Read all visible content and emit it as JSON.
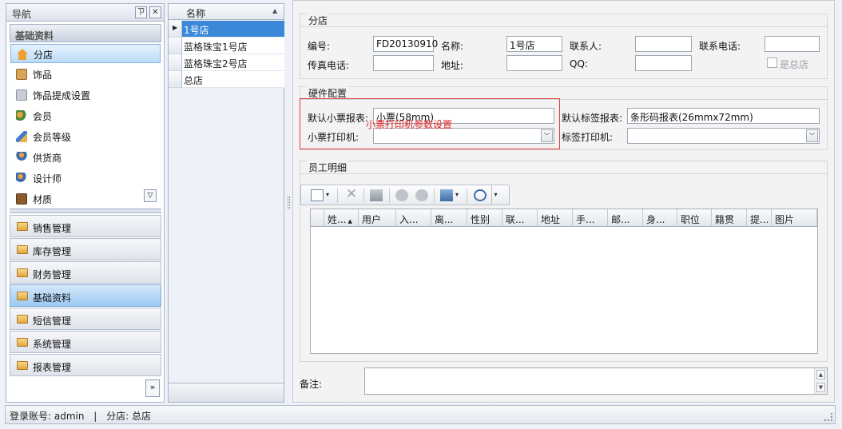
{
  "nav": {
    "title": "导航",
    "pin": "ㄗ",
    "close": "✕",
    "section_title": "基础资料",
    "items": [
      {
        "label": "分店",
        "icon": "home-icon"
      },
      {
        "label": "饰品",
        "icon": "box-icon"
      },
      {
        "label": "饰品提成设置",
        "icon": "gear-doc-icon"
      },
      {
        "label": "会员",
        "icon": "users-icon"
      },
      {
        "label": "会员等级",
        "icon": "pen-icon"
      },
      {
        "label": "供货商",
        "icon": "supplier-icon"
      },
      {
        "label": "设计师",
        "icon": "designer-icon"
      },
      {
        "label": "材质",
        "icon": "material-icon"
      }
    ],
    "groups": [
      "销售管理",
      "库存管理",
      "财务管理",
      "基础资料",
      "短信管理",
      "系统管理",
      "报表管理"
    ]
  },
  "store_list": {
    "header": "名称",
    "rows": [
      "1号店",
      "蓝格珠宝1号店",
      "蓝格珠宝2号店",
      "总店"
    ]
  },
  "store_form": {
    "title": "分店",
    "code_label": "编号:",
    "code_value": "FD20130910",
    "name_label": "名称:",
    "name_value": "1号店",
    "contact_label": "联系人:",
    "contact_value": "",
    "phone_label": "联系电话:",
    "phone_value": "",
    "fax_label": "传真电话:",
    "fax_value": "",
    "address_label": "地址:",
    "address_value": "",
    "qq_label": "QQ:",
    "qq_value": "",
    "headquarters_label": "是总店"
  },
  "hardware": {
    "title": "硬件配置",
    "receipt_report_label": "默认小票报表:",
    "receipt_report_value": "小票(58mm)",
    "label_report_label": "默认标签报表:",
    "label_report_value": "条形码报表(26mmx72mm)",
    "receipt_printer_label": "小票打印机:",
    "receipt_printer_value": "",
    "label_printer_label": "标签打印机:",
    "label_printer_value": "",
    "annotation": "小票打印机参数设置"
  },
  "staff": {
    "title": "员工明细",
    "columns": [
      "姓...",
      "用户",
      "入...",
      "离...",
      "性别",
      "联...",
      "地址",
      "手...",
      "邮...",
      "身...",
      "职位",
      "籍贯",
      "提...",
      "图片"
    ]
  },
  "remark_label": "备注:",
  "status": {
    "account": "登录账号: admin",
    "divider": "|",
    "store": "分店: 总店"
  }
}
